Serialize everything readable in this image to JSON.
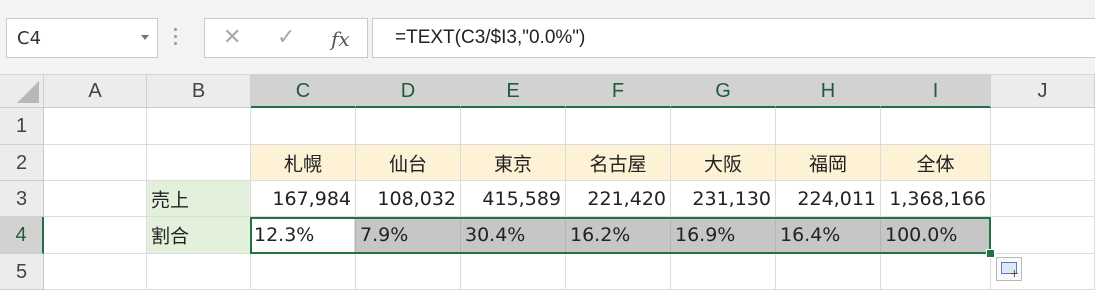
{
  "name_box": {
    "value": "C4"
  },
  "formula_bar": {
    "cancel_symbol": "✕",
    "enter_symbol": "✓",
    "fx_label": "fx",
    "formula": "=TEXT(C3/$I3,\"0.0%\")"
  },
  "columns": [
    "A",
    "B",
    "C",
    "D",
    "E",
    "F",
    "G",
    "H",
    "I",
    "J"
  ],
  "rows": [
    "1",
    "2",
    "3",
    "4",
    "5"
  ],
  "table": {
    "cities": [
      "札幌",
      "仙台",
      "東京",
      "名古屋",
      "大阪",
      "福岡",
      "全体"
    ],
    "sales_label": "売上",
    "sales": [
      "167,984",
      "108,032",
      "415,589",
      "221,420",
      "231,130",
      "224,011",
      "1,368,166"
    ],
    "ratio_label": "割合",
    "ratios": [
      "12.3%",
      "7.9%",
      "30.4%",
      "16.2%",
      "16.9%",
      "16.4%",
      "100.0%"
    ]
  },
  "selection": {
    "active_cell": "C4",
    "range": "C4:I4"
  },
  "colors": {
    "accent": "#217346",
    "header_fill": "#fdf1d6",
    "label_fill": "#e3f0dc",
    "selected_fill": "#c6c6c6"
  },
  "icons": [
    "dropdown-arrow-icon",
    "cancel-icon",
    "enter-icon",
    "fx-icon",
    "select-all-icon",
    "quick-analysis-icon"
  ]
}
